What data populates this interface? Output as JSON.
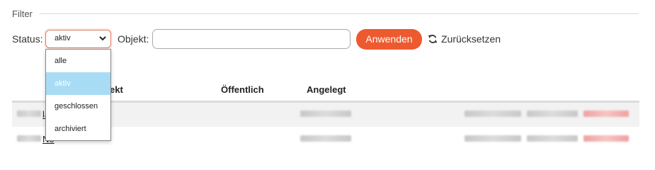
{
  "filter": {
    "legend": "Filter",
    "status_label": "Status:",
    "status_value": "aktiv",
    "status_options": [
      "alle",
      "aktiv",
      "geschlossen",
      "archiviert"
    ],
    "objekt_label": "Objekt:",
    "objekt_value": "",
    "apply_label": "Anwenden",
    "reset_label": "Zurücksetzen"
  },
  "table": {
    "headers": [
      "ekt",
      "Öffentlich",
      "Angelegt"
    ],
    "rows": [
      {
        "link_text": "la"
      },
      {
        "link_text": "Ne"
      }
    ]
  },
  "colors": {
    "accent": "#ee5a2f",
    "selected_option": "#a8dcf5"
  }
}
